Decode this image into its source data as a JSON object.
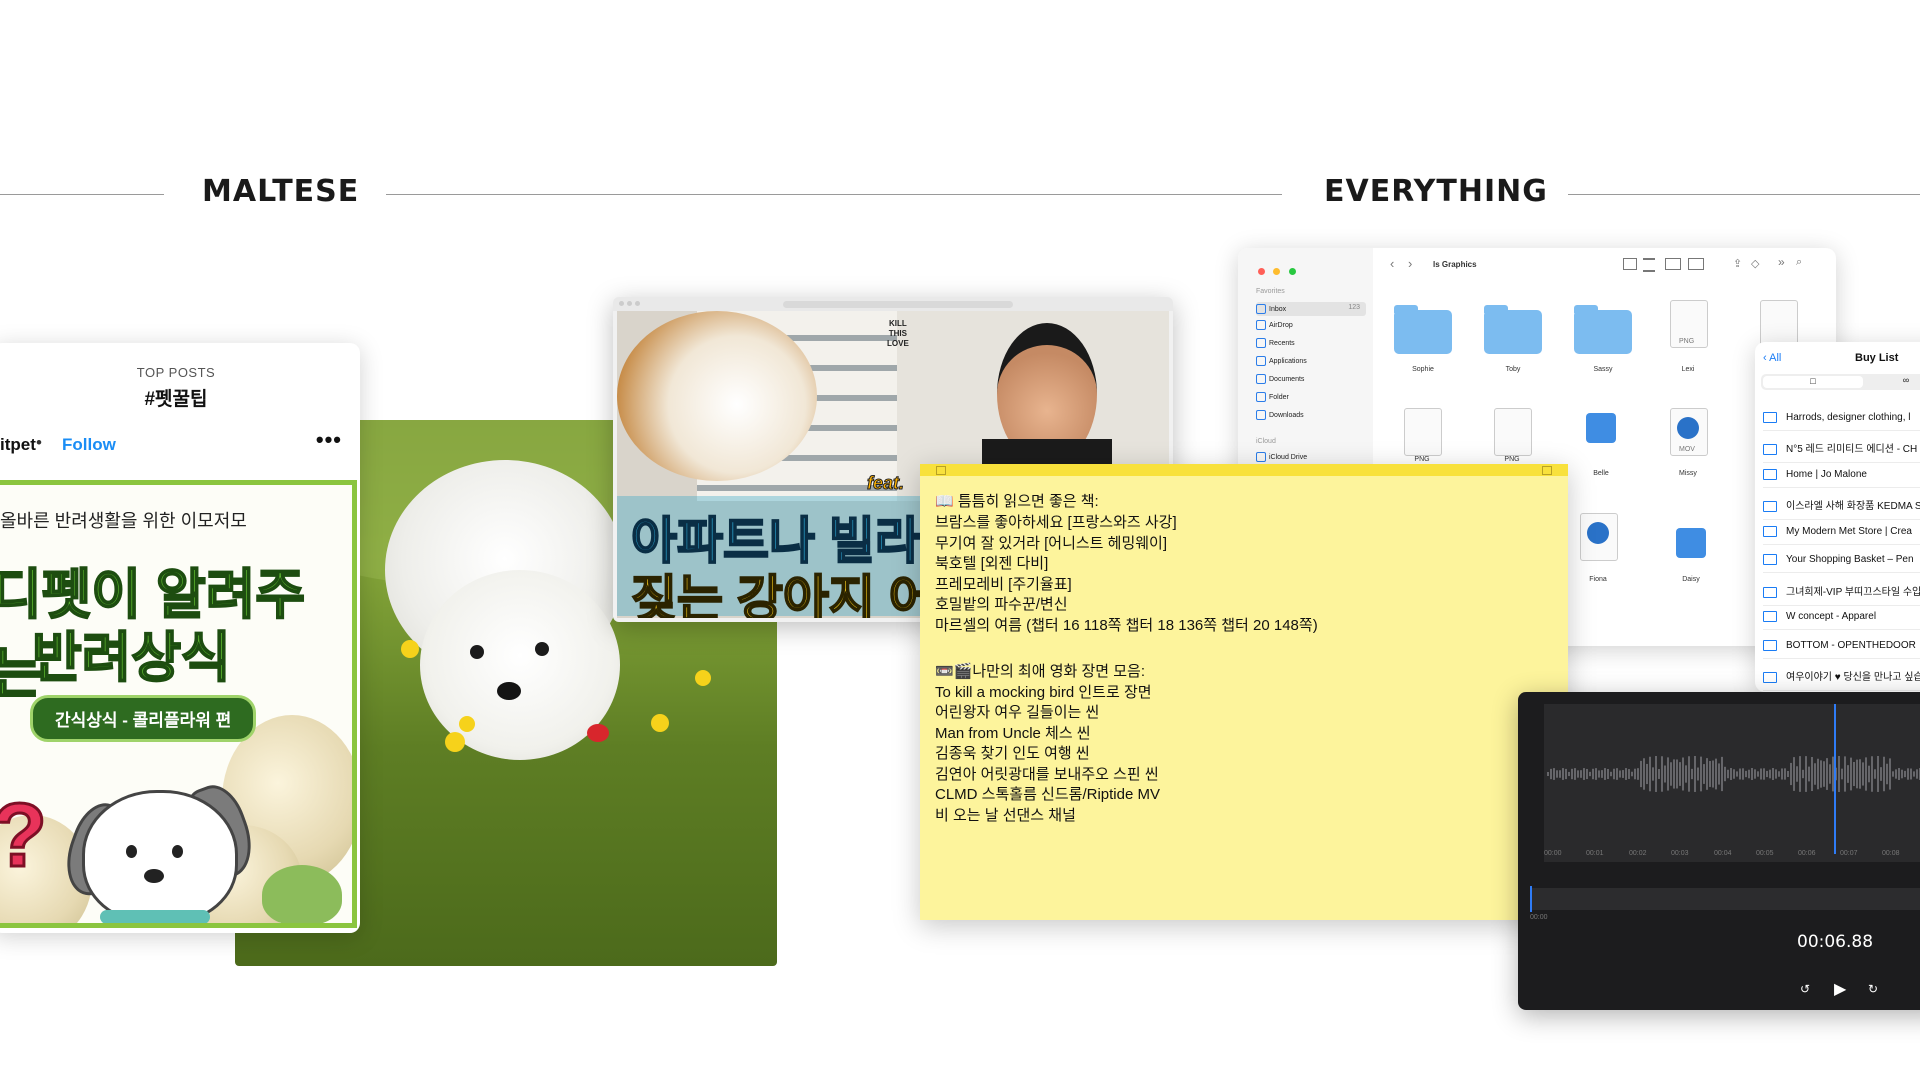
{
  "sections": {
    "left_title": "MALTESE",
    "right_title": "EVERYTHING"
  },
  "instagram": {
    "kicker": "TOP POSTS",
    "hashtag": "#펫꿀팁",
    "username": "itpet",
    "dot": "•",
    "follow": "Follow",
    "more": "•••",
    "art_line1": "올바른 반려생활을 위한 이모저모",
    "art_head1": "디펫이 알려주는",
    "art_head2": "반려상식",
    "art_pill": "간식상식 - 콜리플라워 편",
    "art_question": "?"
  },
  "youtube": {
    "kill_text": "KILL\nTHIS\nLOVE",
    "feat": "feat.",
    "title1": "아파트나 빌라에",
    "title2": "짖는 강아지 어떻"
  },
  "finder": {
    "title": "ls Graphics",
    "sidebar": {
      "favorites_label": "Favorites",
      "items": [
        "Inbox",
        "AirDrop",
        "Recents",
        "Applications",
        "Documents",
        "Folder",
        "Downloads"
      ],
      "inbox_count": "123",
      "icloud_label": "iCloud",
      "icloud_item": "iCloud Drive"
    },
    "files": [
      {
        "name": "Sophie",
        "kind": "folder"
      },
      {
        "name": "Toby",
        "kind": "folder"
      },
      {
        "name": "Sassy",
        "kind": "folder"
      },
      {
        "name": "Lexi",
        "kind": "PNG"
      },
      {
        "name": "PNG",
        "kind": "PNG"
      },
      {
        "name": "PNG",
        "kind": "PNG"
      },
      {
        "name": "Belle",
        "kind": "keynote"
      },
      {
        "name": "Missy",
        "kind": "MOV"
      },
      {
        "name": "Fiona",
        "kind": "MOV"
      },
      {
        "name": "Daisy",
        "kind": "keynote"
      }
    ],
    "badge_png": "PNG",
    "badge_mov": "MOV"
  },
  "buylist": {
    "back": "All",
    "title": "Buy List",
    "rows": [
      "Harrods, designer clothing, l",
      "N°5 레드 리미티드 에디션 - CH",
      "Home | Jo Malone",
      "이스라엘 사해 화장품 KEDMA S",
      "My Modern Met Store | Crea",
      "Your Shopping Basket – Pen",
      "그녀희제-VIP 부띠끄스타일 수입",
      "W concept - Apparel",
      "BOTTOM - OPENTHEDOOR",
      "여우이야기 ♥ 당신을 만나고 싶습"
    ]
  },
  "sticky": {
    "lines": [
      "📖 틈틈히 읽으면 좋은 책:",
      "브람스를 좋아하세요 [프랑스와즈 사강]",
      "무기여 잘 있거라 [어니스트 헤밍웨이]",
      "북호텔 [외젠 다비]",
      "프레모레비 [주기율표]",
      "호밀밭의 파수꾼/변신",
      "마르셀의 여름 (챕터 16 118쪽 챕터 18 136쪽 챕터 20 148쪽)",
      "",
      "📼🎬나만의 최애 영화 장면 모음:",
      "To kill a mocking bird 인트로 장면",
      "어린왕자 여우 길들이는 씬",
      "Man from Uncle 체스 씬",
      "김종욱 찾기 인도 여행 씬",
      "김연아 어릿광대를 보내주오 스핀 씬",
      "CLMD 스톡홀름 신드롬/Riptide MV",
      "비 오는 날 선댄스 채널"
    ]
  },
  "voice_memo": {
    "ticks": [
      "00:00",
      "00:01",
      "00:02",
      "00:03",
      "00:04",
      "00:05",
      "00:06",
      "00:07",
      "00:08"
    ],
    "mini_tick": "00:00",
    "time": "00:06.88",
    "rewind_icon": "↺",
    "play_icon": "▶",
    "forward_icon": "↻"
  },
  "colors": {
    "accent_blue": "#1a8df5",
    "ig_green": "#8bc53f",
    "sticky_yellow": "#fdf49c",
    "voice_bg": "#1c1c1e",
    "playhead_blue": "#2f7cf6"
  }
}
